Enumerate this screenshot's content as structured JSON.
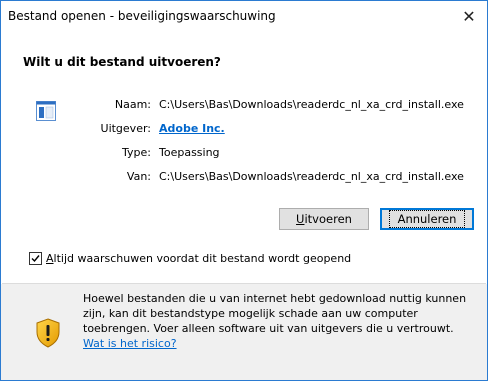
{
  "window": {
    "title": "Bestand openen - beveiligingswaarschuwing",
    "close_glyph": "✕"
  },
  "question": "Wilt u dit bestand uitvoeren?",
  "file_icon": "exe-file-icon",
  "info": {
    "name_label": "Naam:",
    "name_value": "C:\\Users\\Bas\\Downloads\\readerdc_nl_xa_crd_install.exe",
    "publisher_label": "Uitgever:",
    "publisher_value": "Adobe Inc.",
    "type_label": "Type:",
    "type_value": "Toepassing",
    "from_label": "Van:",
    "from_value": "C:\\Users\\Bas\\Downloads\\readerdc_nl_xa_crd_install.exe"
  },
  "buttons": {
    "run_first": "U",
    "run_rest": "itvoeren",
    "cancel": "Annuleren"
  },
  "checkbox": {
    "checked": true,
    "label_first": "A",
    "label_rest": "ltijd waarschuwen voordat dit bestand wordt geopend"
  },
  "warning": {
    "icon": "shield-warning-icon",
    "text": "Hoewel bestanden die u van internet hebt gedownload nuttig kunnen zijn, kan dit bestandstype mogelijk schade aan uw computer toebrengen. Voer alleen software uit van uitgevers die u vertrouwt. ",
    "link": "Wat is het risico?"
  },
  "colors": {
    "accent": "#0078d7",
    "link": "#0066cc",
    "footer_bg": "#f0f0f0"
  }
}
